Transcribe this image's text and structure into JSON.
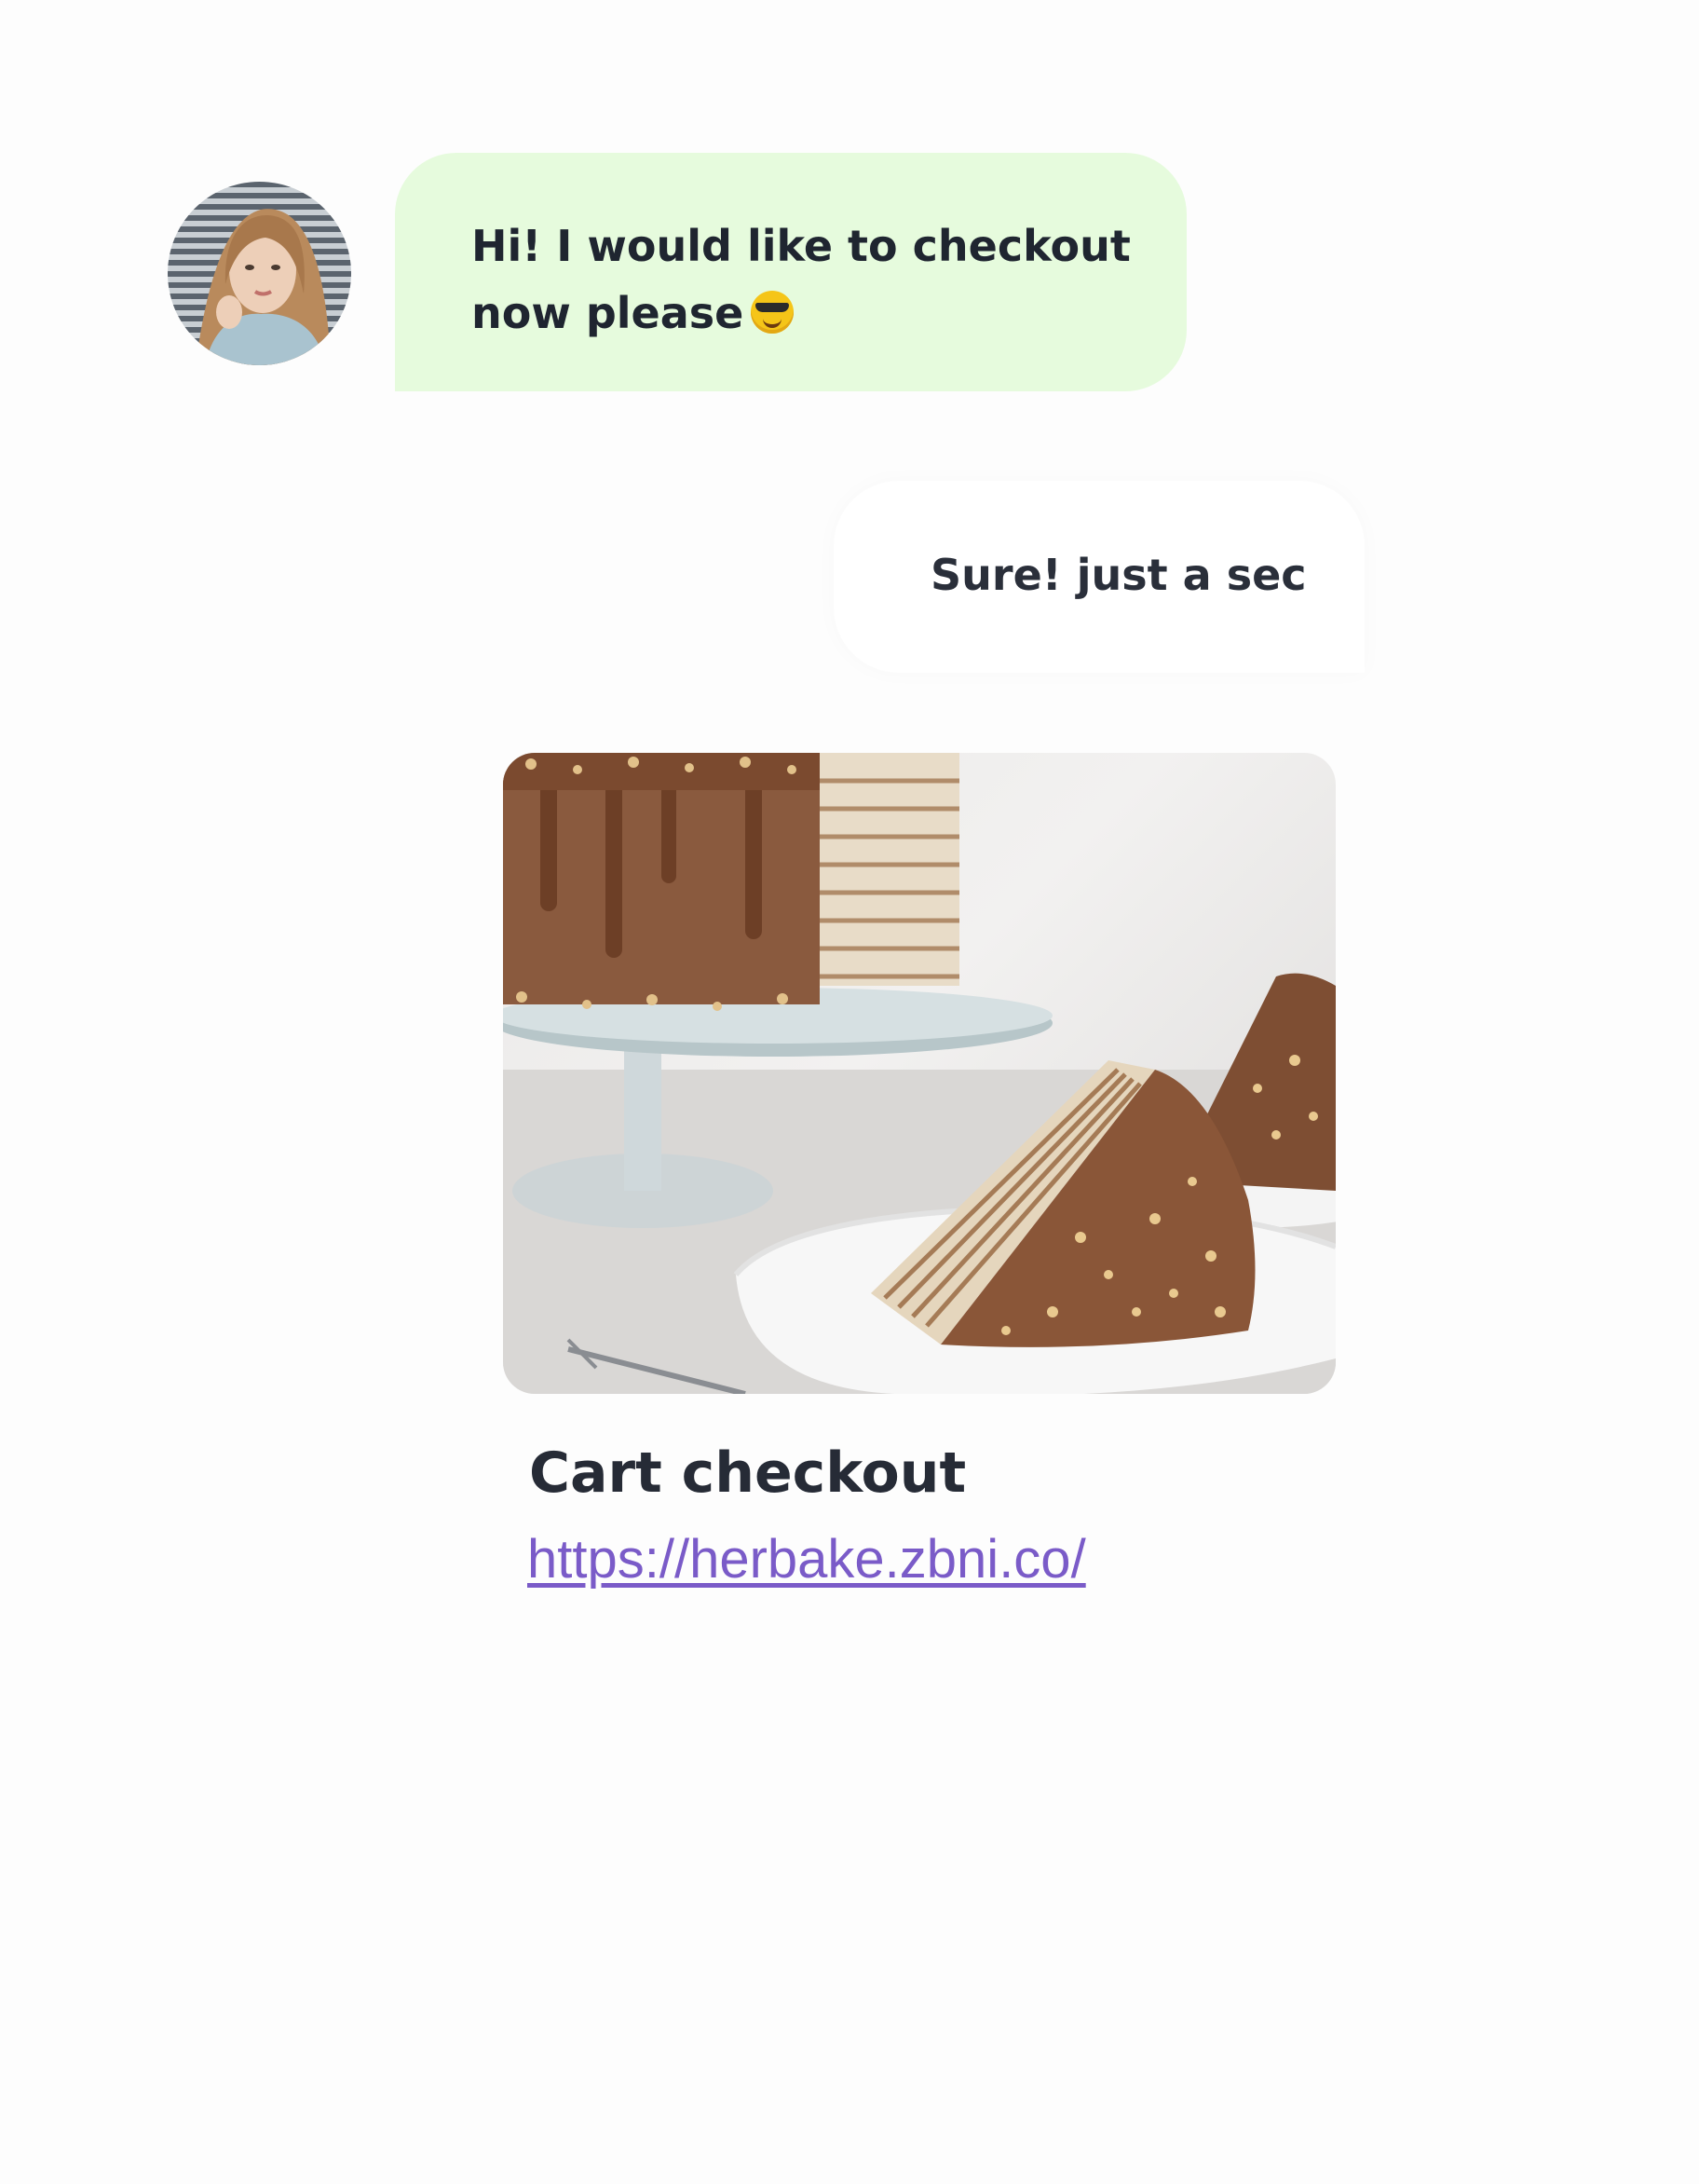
{
  "messages": {
    "incoming": {
      "line1": "Hi! I would like to checkout",
      "line2": "now please",
      "emoji": "smiling-face-with-sunglasses"
    },
    "outgoing": {
      "text": "Sure! just a sec"
    }
  },
  "card": {
    "image_subject": "chocolate crepe cake",
    "title": "Cart checkout",
    "link": "https://herbake.zbni.co/"
  },
  "colors": {
    "incoming_bubble": "#e6fbdd",
    "outgoing_bubble": "#ffffff",
    "link": "#7a5bc8",
    "text": "#262b36"
  }
}
